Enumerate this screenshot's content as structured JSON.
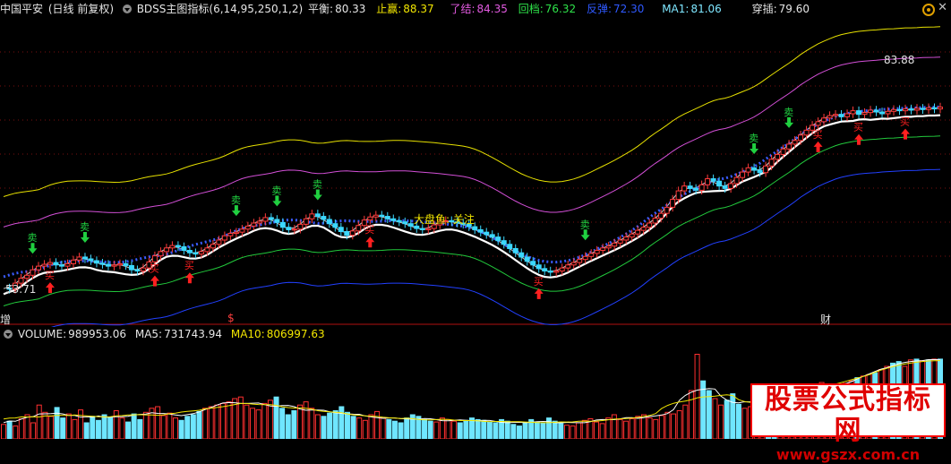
{
  "header": {
    "stock_name": "中国平安",
    "period_mode": "(日线 前复权)",
    "indicator": "BDSS主图指标(6,14,95,250,1,2)",
    "items": [
      {
        "label": "平衡:",
        "value": "80.33",
        "color": "#e6e6e6"
      },
      {
        "label": "止赢:",
        "value": "88.37",
        "color": "#f2e600"
      },
      {
        "label": "了结:",
        "value": "84.35",
        "color": "#e25ae0"
      },
      {
        "label": "回档:",
        "value": "76.32",
        "color": "#2ee34a"
      },
      {
        "label": "反弹:",
        "value": "72.30",
        "color": "#2f59ff"
      },
      {
        "label": "MA1:",
        "value": "81.06",
        "color": "#7fe7ff"
      },
      {
        "label": "穿插:",
        "value": "79.60",
        "color": "#e6e6e6"
      }
    ]
  },
  "volume_header": {
    "items": [
      {
        "label": "VOLUME:",
        "value": "989953.06"
      },
      {
        "label": "MA5:",
        "value": "731743.94"
      },
      {
        "label": "MA10:",
        "value": "806997.63"
      }
    ]
  },
  "annotations": {
    "high_price": "83.88",
    "low_price": "53.71",
    "big_fish": "大盘鱼: 关注",
    "buy_label": "买",
    "sell_label": "卖",
    "marker_left": "增",
    "marker_mid": "$",
    "marker_right": "财"
  },
  "watermark": {
    "title": "股票公式指标网",
    "url": "www.gszx.com.cn"
  },
  "chart_data": [
    {
      "type": "line",
      "title": "BDSS主图指标(6,14,95,250,1,2)",
      "ylim": [
        50,
        95
      ],
      "x": [
        0,
        1,
        2,
        3,
        4,
        5,
        6,
        7,
        8,
        9,
        10,
        11,
        12,
        13,
        14,
        15,
        16,
        17,
        18,
        19,
        20,
        21,
        22,
        23,
        24,
        25,
        26,
        27,
        28,
        29,
        30,
        31,
        32,
        33,
        34,
        35,
        36,
        37,
        38,
        39,
        40,
        41,
        42,
        43,
        44,
        45,
        46,
        47,
        48,
        49,
        50,
        51,
        52,
        53,
        54,
        55,
        56,
        57,
        58,
        59,
        60,
        61,
        62,
        63,
        64,
        65,
        66,
        67,
        68,
        69,
        70,
        71,
        72,
        73,
        74,
        75,
        76,
        77,
        78,
        79,
        80,
        81,
        82,
        83,
        84,
        85,
        86,
        87,
        88,
        89,
        90,
        91,
        92,
        93,
        94,
        95,
        96,
        97,
        98,
        99,
        100,
        101,
        102,
        103,
        104,
        105,
        106,
        107,
        108,
        109,
        110,
        111,
        112,
        113,
        114,
        115,
        116,
        117,
        118,
        119,
        120,
        121,
        122,
        123,
        124,
        125,
        126,
        127,
        128,
        129,
        130,
        131,
        132,
        133,
        134,
        135,
        136,
        137,
        138,
        139,
        140,
        141,
        142,
        143,
        144,
        145,
        146,
        147,
        148,
        149,
        150,
        151,
        152,
        153,
        154,
        155,
        156,
        157,
        158,
        159
      ],
      "close": [
        54.2,
        54.0,
        55.0,
        55.8,
        56.3,
        57.2,
        57.8,
        58.1,
        58.4,
        58.0,
        57.8,
        58.2,
        58.8,
        59.3,
        59.0,
        58.7,
        58.3,
        58.1,
        57.8,
        58.0,
        58.2,
        57.9,
        57.2,
        57.0,
        57.5,
        58.5,
        59.5,
        60.2,
        60.8,
        61.2,
        61.0,
        60.4,
        60.0,
        59.8,
        60.2,
        60.8,
        61.4,
        62.1,
        62.8,
        63.2,
        63.4,
        63.9,
        64.4,
        64.9,
        65.2,
        65.8,
        65.5,
        65.0,
        64.2,
        63.8,
        63.9,
        64.7,
        65.6,
        66.4,
        66.0,
        65.5,
        64.8,
        64.2,
        63.5,
        62.9,
        63.6,
        64.5,
        65.4,
        65.9,
        66.2,
        66.0,
        65.6,
        65.3,
        65.1,
        64.8,
        64.4,
        64.0,
        63.8,
        64.0,
        64.6,
        65.2,
        65.3,
        65.1,
        64.9,
        64.7,
        64.3,
        63.8,
        63.4,
        63.0,
        62.6,
        62.0,
        61.4,
        60.7,
        60.0,
        59.3,
        58.6,
        58.0,
        57.4,
        57.0,
        56.8,
        57.0,
        57.5,
        58.0,
        58.4,
        58.9,
        59.4,
        59.9,
        60.4,
        60.8,
        61.1,
        61.6,
        62.1,
        62.6,
        63.1,
        63.7,
        64.2,
        64.9,
        65.7,
        66.5,
        67.5,
        68.8,
        70.2,
        71.0,
        70.6,
        70.3,
        71.2,
        72.2,
        71.8,
        71.0,
        70.6,
        71.4,
        72.4,
        73.3,
        74.0,
        73.6,
        73.2,
        74.3,
        75.4,
        76.2,
        77.1,
        77.9,
        78.5,
        79.4,
        80.2,
        81.0,
        81.6,
        82.2,
        82.6,
        82.8,
        82.4,
        82.9,
        83.4,
        82.8,
        83.1,
        83.5,
        83.2,
        82.9,
        83.3,
        83.6,
        83.4,
        83.7,
        83.5,
        83.8,
        83.6,
        83.9,
        83.7,
        84.0
      ],
      "series": [
        {
          "name": "平衡",
          "color": "#ffffff"
        },
        {
          "name": "止赢",
          "color": "#e6e000"
        },
        {
          "name": "了结",
          "color": "#d24fd6"
        },
        {
          "name": "回档",
          "color": "#22c93c"
        },
        {
          "name": "反弹",
          "color": "#2240ff"
        },
        {
          "name": "MA1",
          "color": "#7fe7ff"
        },
        {
          "name": "穿插",
          "color": "#ffffff"
        }
      ]
    },
    {
      "type": "bar",
      "title": "VOLUME",
      "ylim": [
        0,
        1200000
      ],
      "values": [
        180000,
        220000,
        160000,
        250000,
        300000,
        200000,
        420000,
        330000,
        280000,
        390000,
        260000,
        310000,
        240000,
        360000,
        200000,
        280000,
        230000,
        300000,
        270000,
        350000,
        260000,
        210000,
        310000,
        240000,
        330000,
        380000,
        400000,
        290000,
        320000,
        260000,
        230000,
        280000,
        300000,
        340000,
        380000,
        400000,
        420000,
        440000,
        460000,
        500000,
        520000,
        420000,
        380000,
        360000,
        440000,
        480000,
        520000,
        380000,
        300000,
        350000,
        420000,
        460000,
        380000,
        300000,
        280000,
        320000,
        350000,
        400000,
        330000,
        280000,
        260000,
        230000,
        300000,
        340000,
        260000,
        240000,
        220000,
        200000,
        260000,
        300000,
        280000,
        240000,
        220000,
        210000,
        260000,
        240000,
        220000,
        200000,
        230000,
        260000,
        240000,
        230000,
        210000,
        200000,
        240000,
        220000,
        180000,
        160000,
        200000,
        240000,
        210000,
        200000,
        260000,
        220000,
        190000,
        170000,
        160000,
        200000,
        230000,
        250000,
        210000,
        190000,
        260000,
        300000,
        240000,
        220000,
        250000,
        280000,
        300000,
        260000,
        240000,
        290000,
        330000,
        310000,
        350000,
        420000,
        600000,
        1050000,
        720000,
        600000,
        500000,
        420000,
        480000,
        560000,
        430000,
        380000,
        400000,
        460000,
        520000,
        470000,
        380000,
        420000,
        480000,
        520000,
        560000,
        600000,
        640000,
        660000,
        700000,
        620000,
        580000,
        640000,
        690000,
        720000,
        760000,
        780000,
        800000,
        820000,
        860000,
        900000,
        940000,
        960000,
        900000,
        980000,
        990000,
        970000,
        980000,
        990000,
        989953
      ]
    }
  ]
}
